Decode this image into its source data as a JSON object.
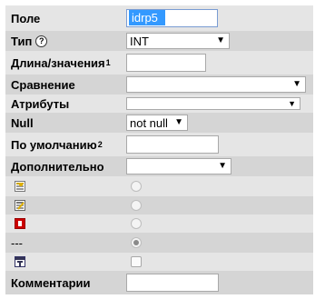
{
  "fields": {
    "name": {
      "label": "Поле",
      "value": "idrp5"
    },
    "type": {
      "label": "Тип",
      "help_icon": "question-circle-icon",
      "value": "INT"
    },
    "length": {
      "label": "Длина/значения",
      "sup": "1",
      "value": ""
    },
    "collation": {
      "label": "Сравнение",
      "value": ""
    },
    "attributes": {
      "label": "Атрибуты",
      "value": ""
    },
    "null": {
      "label": "Null",
      "value": "not null"
    },
    "default": {
      "label": "По умолчанию",
      "sup": "2",
      "value": ""
    },
    "extra": {
      "label": "Дополнительно",
      "value": ""
    },
    "index_primary": {
      "icon": "primary-key-icon",
      "checked": false
    },
    "index_index": {
      "icon": "index-icon",
      "checked": false
    },
    "index_unique": {
      "icon": "unique-icon",
      "checked": false
    },
    "index_none": {
      "label": "---",
      "checked": true
    },
    "fulltext": {
      "icon": "fulltext-icon",
      "checked": false
    },
    "comment": {
      "label": "Комментарии",
      "value": ""
    }
  },
  "colors": {
    "row_light": "#e5e5e5",
    "row_dark": "#d5d5d5",
    "selection": "#3399ff"
  }
}
